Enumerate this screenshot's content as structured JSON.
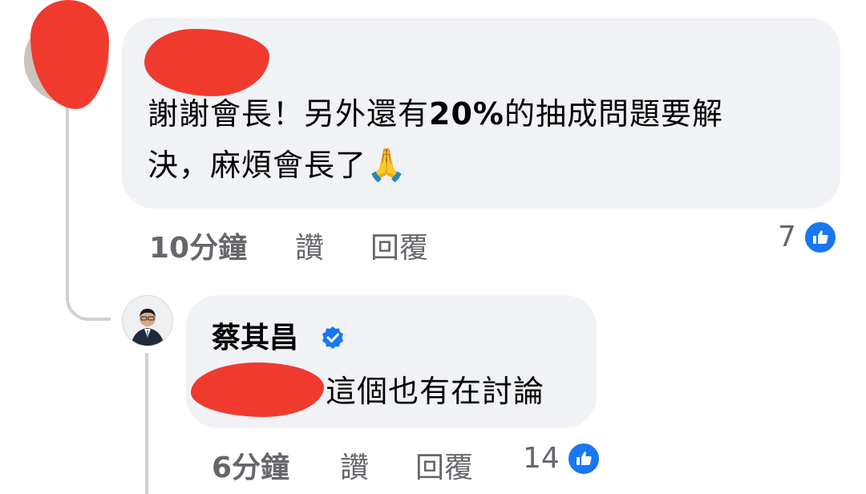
{
  "comments": [
    {
      "author": "",
      "text_before": "謝謝會長！另外還有",
      "text_bold": "20%",
      "text_after_line1": "的抽成問題要解",
      "text_line2": "決，麻煩會長了",
      "emoji": "🙏",
      "timestamp": "10分鐘",
      "like_label": "讚",
      "reply_label": "回覆",
      "reaction_count": "7",
      "reaction_icon": "like-thumb-icon"
    },
    {
      "author": "蔡其昌",
      "verified": true,
      "text": "這個也有在討論",
      "timestamp": "6分鐘",
      "like_label": "讚",
      "reply_label": "回覆",
      "reaction_count": "14",
      "reaction_icon": "like-thumb-icon"
    }
  ],
  "colors": {
    "bubble_bg": "#f0f2f5",
    "secondary_text": "#65676b",
    "like_blue": "#1877f2",
    "redaction": "#f03a2e",
    "thread_line": "#ced0d4"
  }
}
